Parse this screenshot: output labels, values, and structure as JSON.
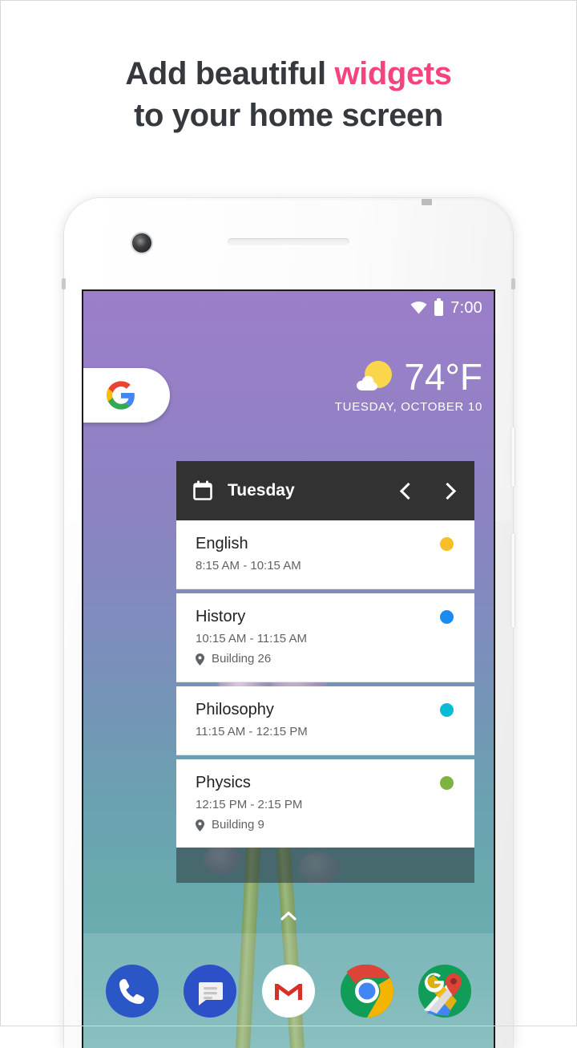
{
  "headline": {
    "line1_prefix": "Add beautiful ",
    "line1_accent": "widgets",
    "line2": "to your home screen",
    "accent_color": "#f5447d"
  },
  "phone": {
    "camera": "camera-icon",
    "earpiece": "earpiece-speaker"
  },
  "statusbar": {
    "wifi": "wifi-icon",
    "battery": "battery-icon",
    "clock": "7:00"
  },
  "search_widget": {
    "logo": "google-g-logo"
  },
  "weather": {
    "icon": "sun-behind-cloud-icon",
    "temperature": "74°F",
    "date": "TUESDAY, OCTOBER 10"
  },
  "calendar_widget": {
    "header": {
      "icon": "calendar-icon",
      "title": "Tuesday",
      "prev_label": "chevron-left-icon",
      "next_label": "chevron-right-icon"
    },
    "events": [
      {
        "title": "English",
        "time": "8:15 AM - 10:15 AM",
        "location": "",
        "dot_color": "#f6bf26"
      },
      {
        "title": "History",
        "time": "10:15 AM - 11:15 AM",
        "location": "Building 26",
        "dot_color": "#1a8cf0"
      },
      {
        "title": "Philosophy",
        "time": "11:15 AM - 12:15 PM",
        "location": "",
        "dot_color": "#06bcd4"
      },
      {
        "title": "Physics",
        "time": "12:15 PM - 2:15 PM",
        "location": "Building 9",
        "dot_color": "#7cb342"
      }
    ]
  },
  "home": {
    "app_drawer_handle": "chevron-up-icon"
  },
  "dock": {
    "apps": [
      {
        "name": "Phone",
        "icon": "phone-icon"
      },
      {
        "name": "Messages",
        "icon": "messages-icon"
      },
      {
        "name": "Gmail",
        "icon": "gmail-icon"
      },
      {
        "name": "Chrome",
        "icon": "chrome-icon"
      },
      {
        "name": "Maps",
        "icon": "maps-icon"
      }
    ]
  }
}
